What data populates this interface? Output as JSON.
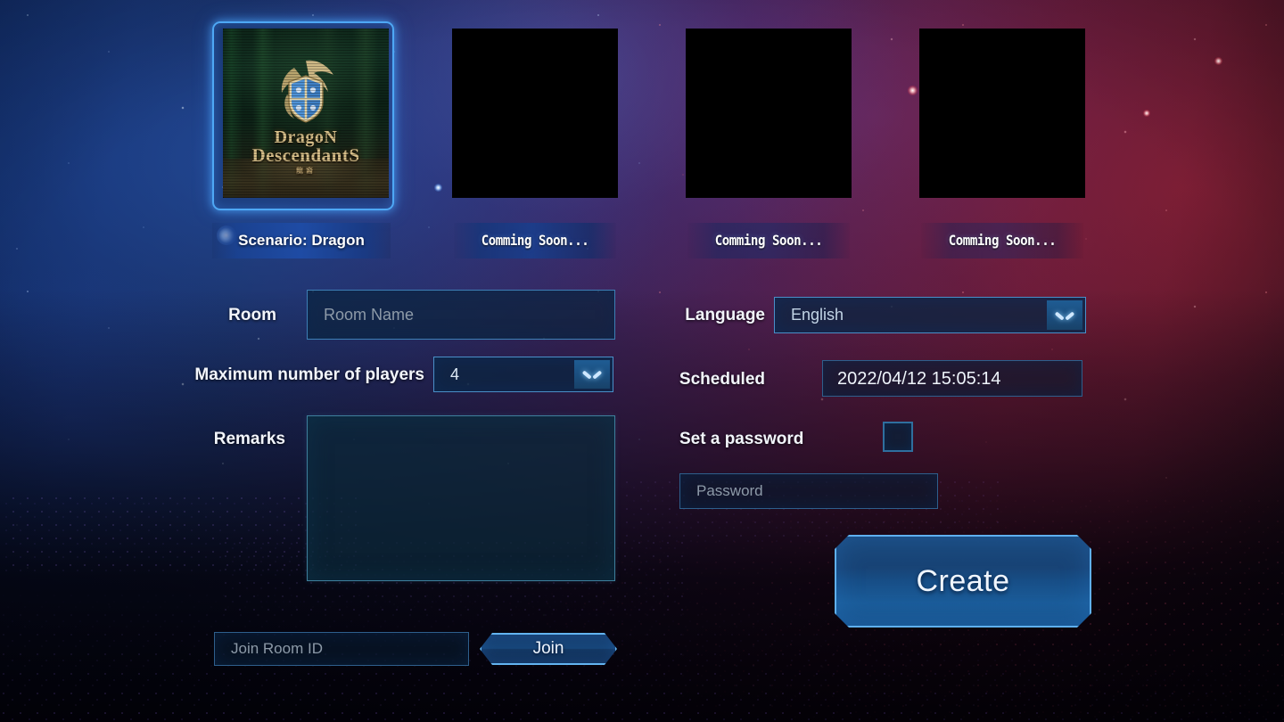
{
  "scenarios": [
    {
      "label": "Scenario: Dragon",
      "selected": true,
      "art_title_line1": "DragoN",
      "art_title_line2": "DescendantS",
      "art_title_line3": "龍裔"
    },
    {
      "label": "Comming Soon...",
      "selected": false
    },
    {
      "label": "Comming Soon...",
      "selected": false
    },
    {
      "label": "Comming Soon...",
      "selected": false
    }
  ],
  "form": {
    "room_label": "Room",
    "room_placeholder": "Room Name",
    "room_value": "",
    "max_players_label": "Maximum number of players",
    "max_players_value": "4",
    "remarks_label": "Remarks",
    "remarks_value": "",
    "language_label": "Language",
    "language_value": "English",
    "scheduled_label": "Scheduled",
    "scheduled_value": "2022/04/12 15:05:14",
    "set_password_label": "Set a password",
    "set_password_checked": false,
    "password_placeholder": "Password",
    "password_value": ""
  },
  "actions": {
    "create_label": "Create",
    "join_label": "Join",
    "join_room_placeholder": "Join Room ID",
    "join_room_value": ""
  },
  "colors": {
    "accent_blue": "#4ea8f5",
    "border_blue": "#3d7fb5",
    "field_bg": "#0c243e",
    "label_text": "#f2f5fb",
    "placeholder": "#8d9aa8",
    "crest_gold": "#d8c08a"
  }
}
